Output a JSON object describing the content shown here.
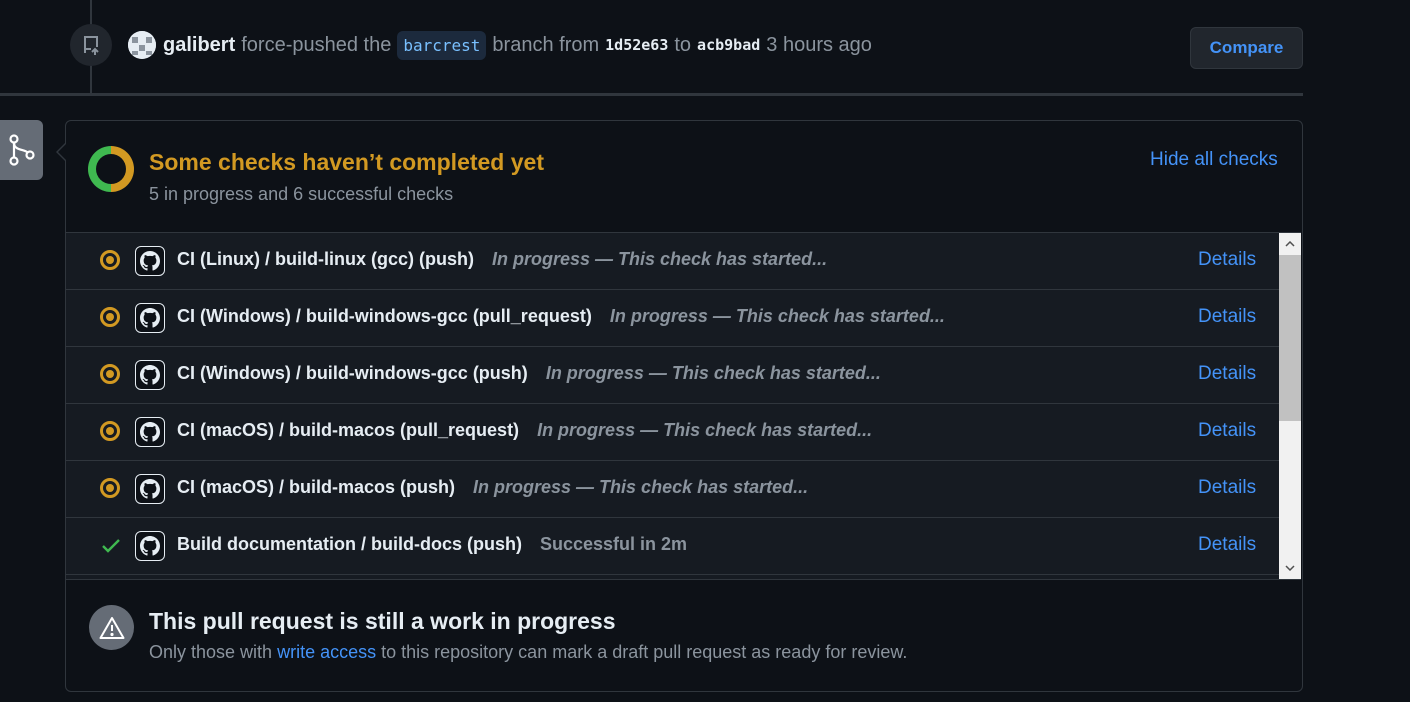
{
  "event": {
    "actor": "galibert",
    "action": "force-pushed the",
    "branch": "barcrest",
    "from_word": "branch from",
    "from_sha": "1d52e63",
    "to_word": "to",
    "to_sha": "acb9bad",
    "time": "3 hours ago",
    "compare_label": "Compare"
  },
  "checks": {
    "title": "Some checks haven’t completed yet",
    "subtitle": "5 in progress and 6 successful checks",
    "hide_label": "Hide all checks",
    "progress": {
      "in_progress": 5,
      "successful": 6
    },
    "items": [
      {
        "name": "CI (Linux) / build-linux (gcc) (push)",
        "description": "In progress — This check has started...",
        "status": "in-progress",
        "details": "Details"
      },
      {
        "name": "CI (Windows) / build-windows-gcc (pull_request)",
        "description": "In progress — This check has started...",
        "status": "in-progress",
        "details": "Details"
      },
      {
        "name": "CI (Windows) / build-windows-gcc (push)",
        "description": "In progress — This check has started...",
        "status": "in-progress",
        "details": "Details"
      },
      {
        "name": "CI (macOS) / build-macos (pull_request)",
        "description": "In progress — This check has started...",
        "status": "in-progress",
        "details": "Details"
      },
      {
        "name": "CI (macOS) / build-macos (push)",
        "description": "In progress — This check has started...",
        "status": "in-progress",
        "details": "Details"
      },
      {
        "name": "Build documentation / build-docs (push)",
        "description": "Successful in 2m",
        "status": "success",
        "details": "Details"
      }
    ]
  },
  "draft": {
    "title": "This pull request is still a work in progress",
    "text_before": "Only those with",
    "link": "write access",
    "text_after": "to this repository can mark a draft pull request as ready for review."
  },
  "colors": {
    "background": "#0d1117",
    "accent_link": "#4493f8",
    "pending": "#d29922",
    "success": "#3fb950",
    "muted": "#8b949e"
  },
  "icons": {
    "push": "repo-push-icon",
    "merge": "git-merge-icon",
    "github": "github-mark-icon",
    "warning": "alert-icon",
    "pending": "dot-fill-icon",
    "success": "check-icon"
  }
}
